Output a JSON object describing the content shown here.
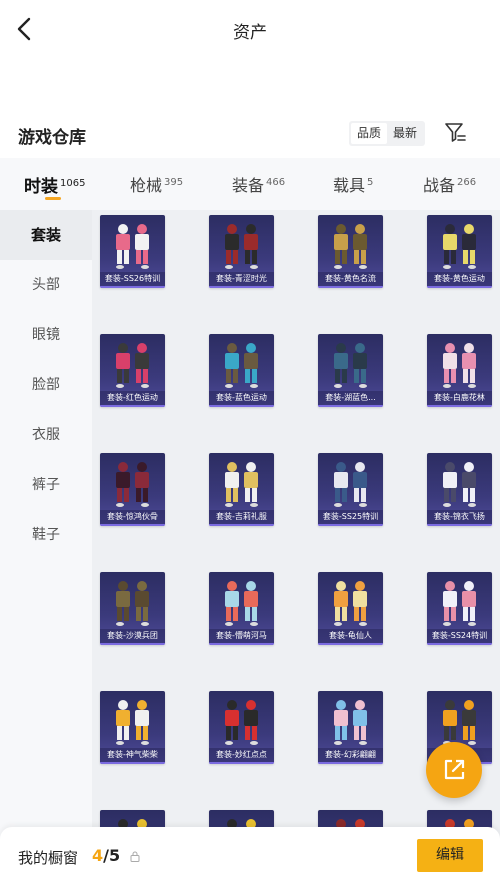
{
  "header": {
    "title": "资产"
  },
  "warehouse": {
    "title": "游戏仓库",
    "sort_options": [
      "品质",
      "最新"
    ],
    "sort_active": "品质"
  },
  "tabs": [
    {
      "label": "时装",
      "count": "1065",
      "active": true
    },
    {
      "label": "枪械",
      "count": "395",
      "active": false
    },
    {
      "label": "装备",
      "count": "466",
      "active": false
    },
    {
      "label": "载具",
      "count": "5",
      "active": false
    },
    {
      "label": "战备",
      "count": "266",
      "active": false
    }
  ],
  "sidebar": {
    "items": [
      {
        "label": "套装",
        "active": true
      },
      {
        "label": "头部",
        "active": false
      },
      {
        "label": "眼镜",
        "active": false
      },
      {
        "label": "脸部",
        "active": false
      },
      {
        "label": "衣服",
        "active": false
      },
      {
        "label": "裤子",
        "active": false
      },
      {
        "label": "鞋子",
        "active": false
      }
    ]
  },
  "items": [
    {
      "label": "套装-SS26特训",
      "colors": [
        "#e86a8a",
        "#f2f2f2"
      ]
    },
    {
      "label": "套装-青涩时光",
      "colors": [
        "#2b2b2b",
        "#9b2b2b"
      ]
    },
    {
      "label": "套装-黄色名流",
      "colors": [
        "#c8a04a",
        "#6b5a30"
      ]
    },
    {
      "label": "套装-黄色运动",
      "colors": [
        "#e8d86a",
        "#2a2a3a"
      ]
    },
    {
      "label": "套装-红色运动",
      "colors": [
        "#d8406a",
        "#3a3a3a"
      ]
    },
    {
      "label": "套装-蓝色运动",
      "colors": [
        "#3aa8c8",
        "#6a5a40"
      ]
    },
    {
      "label": "套装-湖蓝色...",
      "colors": [
        "#3a6a8a",
        "#2a3a4a"
      ]
    },
    {
      "label": "套装-白鹿花林",
      "colors": [
        "#f0e0e8",
        "#e890b0"
      ]
    },
    {
      "label": "套装-惊鸿伙骨",
      "colors": [
        "#3a1a2a",
        "#8a2a3a"
      ]
    },
    {
      "label": "套装-吉莉礼服",
      "colors": [
        "#f0f0f0",
        "#e0c060"
      ]
    },
    {
      "label": "套装-SS25特训",
      "colors": [
        "#e8e8f0",
        "#3a5a8a"
      ]
    },
    {
      "label": "套装-锦衣飞扬",
      "colors": [
        "#f0f0f8",
        "#4a4a6a"
      ]
    },
    {
      "label": "套装-沙漠兵团",
      "colors": [
        "#7a6a40",
        "#5a4a30"
      ]
    },
    {
      "label": "套装-懵萌河马",
      "colors": [
        "#a8d8e8",
        "#e86a5a"
      ]
    },
    {
      "label": "套装-龟仙人",
      "colors": [
        "#f0a040",
        "#f0e0a0"
      ]
    },
    {
      "label": "套装-SS24特训",
      "colors": [
        "#f0f0f8",
        "#e890a8"
      ]
    },
    {
      "label": "套装-神气柴柴",
      "colors": [
        "#f0b030",
        "#f0f0f0"
      ]
    },
    {
      "label": "套装-妙红点点",
      "colors": [
        "#d83030",
        "#2a2a2a"
      ]
    },
    {
      "label": "套装-幻彩翩翩",
      "colors": [
        "#f0c0d0",
        "#80c0e8"
      ]
    },
    {
      "label": "套装-...",
      "colors": [
        "#f0a020",
        "#3a3a3a"
      ]
    },
    {
      "label": "",
      "colors": [
        "#e8c030",
        "#2a2a2a"
      ]
    },
    {
      "label": "",
      "colors": [
        "#e8c030",
        "#2a2a2a"
      ]
    },
    {
      "label": "",
      "colors": [
        "#c83a2a",
        "#8a2a2a"
      ]
    },
    {
      "label": "",
      "colors": [
        "#f0a020",
        "#c83a2a"
      ]
    }
  ],
  "showcase": {
    "label": "我的橱窗",
    "current": "4",
    "total": "/5",
    "lock_icon": "lock-icon"
  },
  "edit_button": "编辑",
  "colors": {
    "accent": "#f5a512",
    "card_bg": "#3b3a7c"
  }
}
